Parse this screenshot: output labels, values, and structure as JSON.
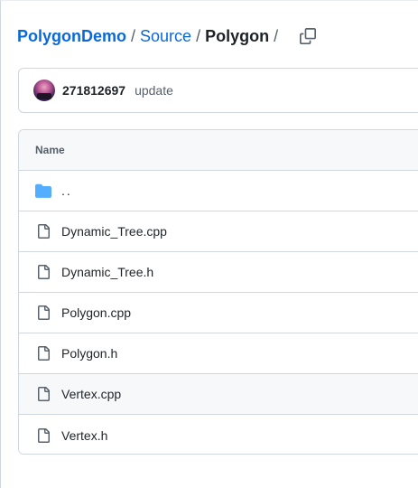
{
  "breadcrumb": {
    "repo": "PolygonDemo",
    "folder": "Source",
    "current": "Polygon",
    "separator": "/",
    "copy_icon": "copy-icon"
  },
  "commit": {
    "author": "271812697",
    "message": "update",
    "avatar_icon": "avatar"
  },
  "table": {
    "header": "Name",
    "rows": [
      {
        "name": "..",
        "icon": "folder-icon",
        "type": "parent-directory"
      },
      {
        "name": "Dynamic_Tree.cpp",
        "icon": "file-icon",
        "type": "file"
      },
      {
        "name": "Dynamic_Tree.h",
        "icon": "file-icon",
        "type": "file"
      },
      {
        "name": "Polygon.cpp",
        "icon": "file-icon",
        "type": "file"
      },
      {
        "name": "Polygon.h",
        "icon": "file-icon",
        "type": "file"
      },
      {
        "name": "Vertex.cpp",
        "icon": "file-icon",
        "type": "file",
        "hovered": true
      },
      {
        "name": "Vertex.h",
        "icon": "file-icon",
        "type": "file"
      }
    ]
  },
  "colors": {
    "link": "#0969da",
    "folder": "#54aeff",
    "file_icon": "#59636e",
    "border": "#d0d7de",
    "header_bg": "#f6f8fa"
  }
}
